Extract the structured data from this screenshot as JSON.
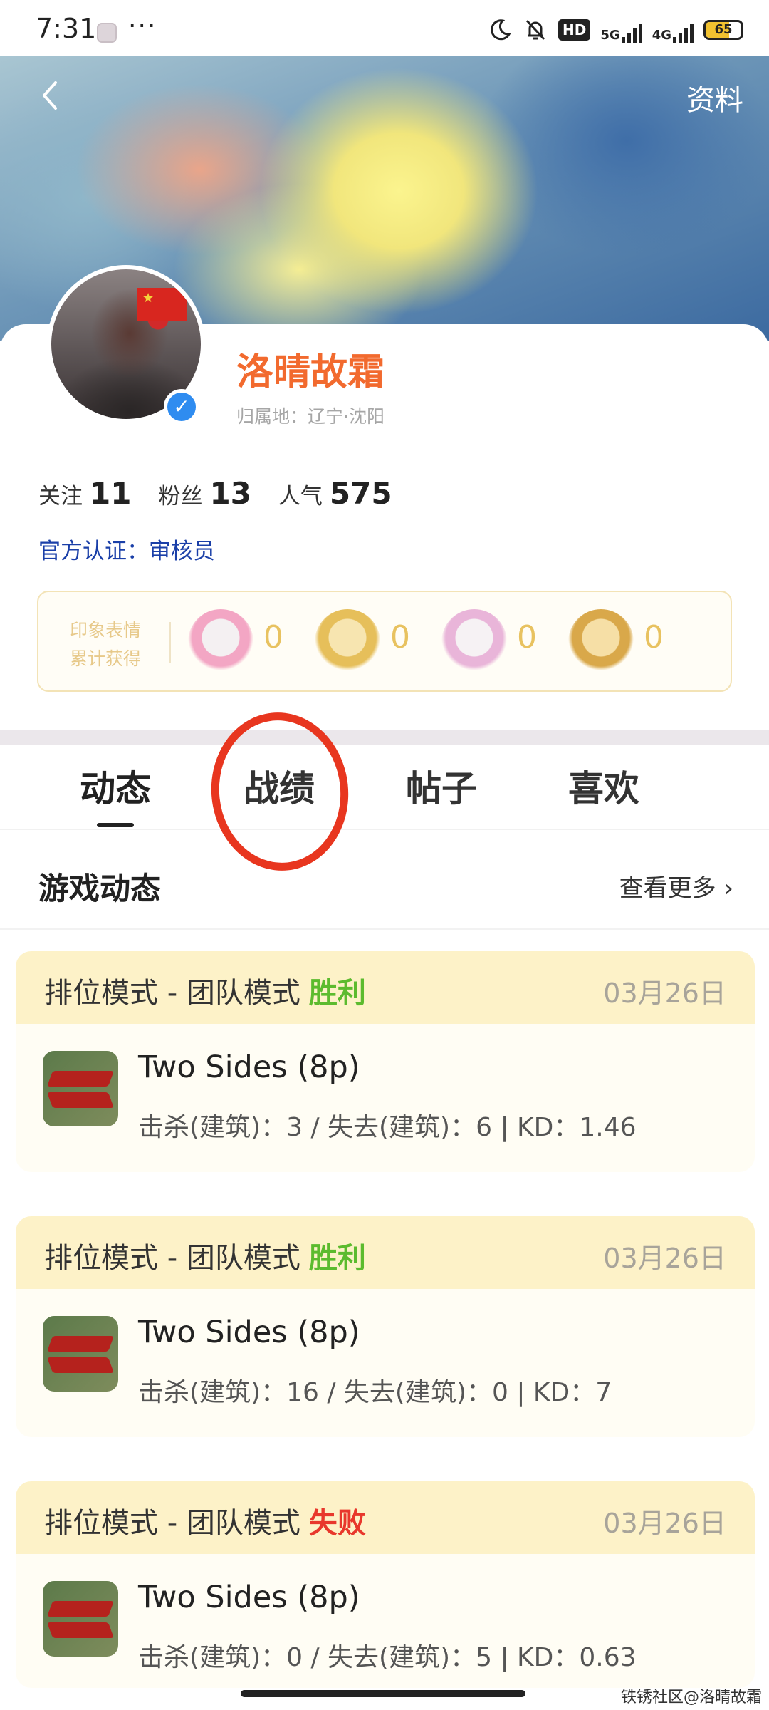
{
  "status_bar": {
    "time": "7:31",
    "dots": "···",
    "network_5g": "5G",
    "network_4g": "4G",
    "hd": "HD",
    "battery": "65",
    "battery_fill": 0.65
  },
  "header": {
    "profile_link": "资料"
  },
  "profile": {
    "name": "洛晴故霜",
    "location": "归属地：辽宁·沈阳",
    "stats": [
      {
        "label": "关注",
        "value": "11"
      },
      {
        "label": "粉丝",
        "value": "13"
      },
      {
        "label": "人气",
        "value": "575"
      }
    ],
    "certification": "官方认证：审核员",
    "impressions": {
      "title": "印象表情累计获得",
      "emojis": [
        {
          "icon": "pink-heart-girl-emoji-icon",
          "count": "0"
        },
        {
          "icon": "blonde-chibi-emoji-icon",
          "count": "0"
        },
        {
          "icon": "white-hair-girl-emoji-icon",
          "count": "0"
        },
        {
          "icon": "blonde-sign-emoji-icon",
          "count": "0"
        }
      ]
    }
  },
  "tabs": [
    {
      "label": "动态",
      "active": true
    },
    {
      "label": "战绩",
      "active": false
    },
    {
      "label": "帖子",
      "active": false
    },
    {
      "label": "喜欢",
      "active": false
    }
  ],
  "activity": {
    "title": "游戏动态",
    "see_more": "查看更多 ›"
  },
  "matches": [
    {
      "mode": "排位模式 - 团队模式",
      "result": "胜利",
      "result_type": "win",
      "date": "03月26日",
      "map": "Two Sides (8p)",
      "stats": "击杀(建筑)：3 / 失去(建筑)：6 | KD：1.46"
    },
    {
      "mode": "排位模式 - 团队模式",
      "result": "胜利",
      "result_type": "win",
      "date": "03月26日",
      "map": "Two Sides (8p)",
      "stats": "击杀(建筑)：16 / 失去(建筑)：0 | KD：7"
    },
    {
      "mode": "排位模式 - 团队模式",
      "result": "失败",
      "result_type": "lose",
      "date": "03月26日",
      "map": "Two Sides (8p)",
      "stats": "击杀(建筑)：0 / 失去(建筑)：5 | KD：0.63"
    }
  ],
  "watermark": "铁锈社区@洛晴故霜",
  "colors": {
    "username": "#f26a2e",
    "certification": "#1a3fa8",
    "win": "#5cbb2e",
    "lose": "#e8382c",
    "annotation": "#e8361f"
  }
}
